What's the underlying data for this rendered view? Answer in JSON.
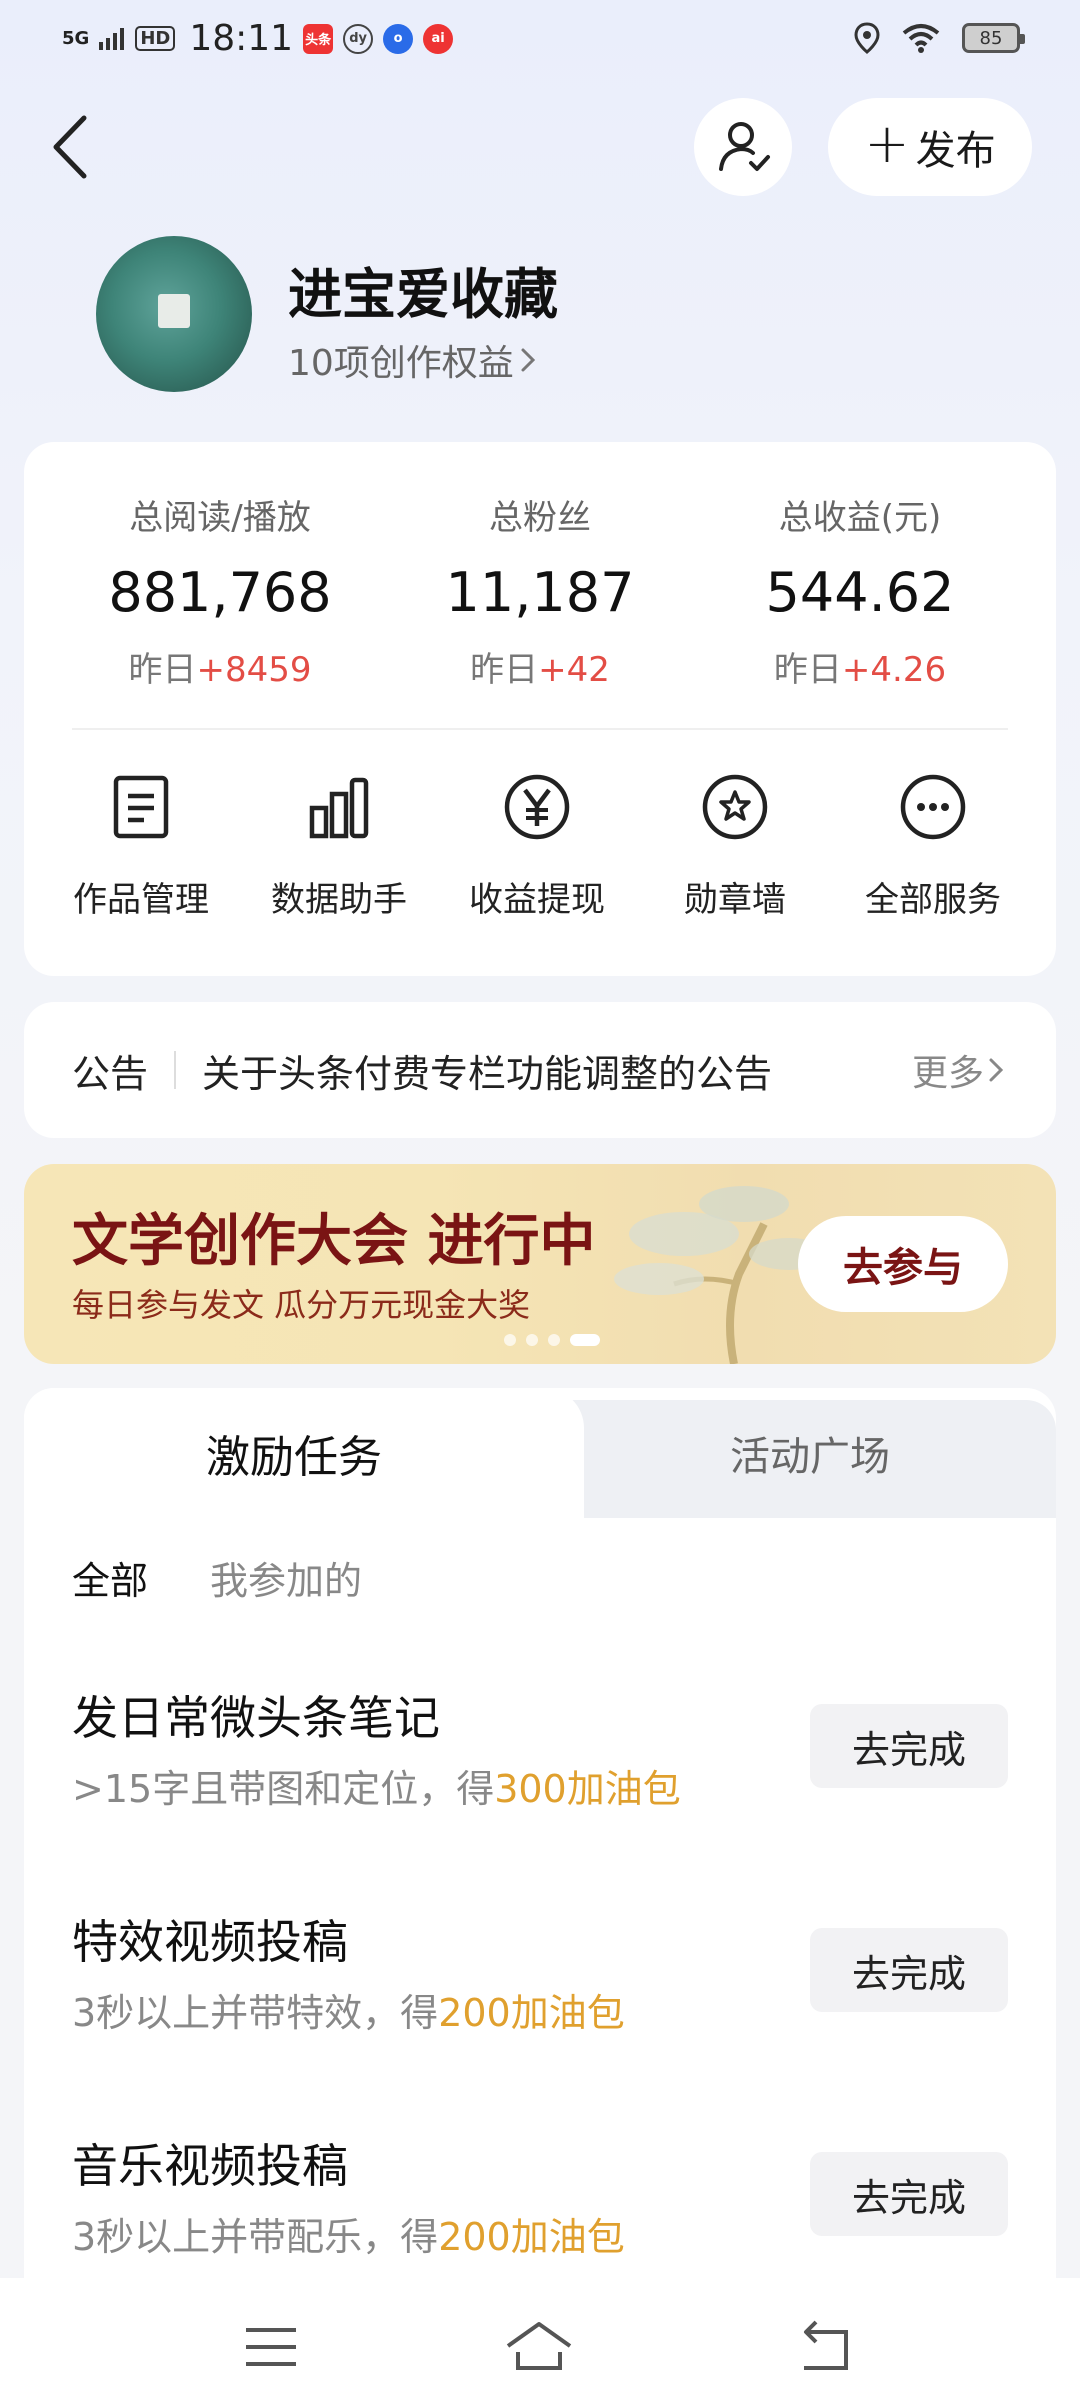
{
  "status_bar": {
    "network": "5G",
    "hd": "HD",
    "time": "18:11",
    "apps": [
      "头条",
      "dy",
      "o",
      "ai"
    ],
    "battery": "85"
  },
  "header": {
    "publish_label": "发布"
  },
  "profile": {
    "name": "进宝爱收藏",
    "subtitle": "10项创作权益"
  },
  "stats": [
    {
      "label": "总阅读/播放",
      "value": "881,768",
      "delta_prefix": "昨日",
      "delta": "+8459"
    },
    {
      "label": "总粉丝",
      "value": "11,187",
      "delta_prefix": "昨日",
      "delta": "+42"
    },
    {
      "label": "总收益(元)",
      "value": "544.62",
      "delta_prefix": "昨日",
      "delta": "+4.26"
    }
  ],
  "services": [
    {
      "label": "作品管理",
      "icon": "document-icon"
    },
    {
      "label": "数据助手",
      "icon": "bar-chart-icon"
    },
    {
      "label": "收益提现",
      "icon": "yuan-icon"
    },
    {
      "label": "勋章墙",
      "icon": "medal-icon"
    },
    {
      "label": "全部服务",
      "icon": "more-icon"
    }
  ],
  "notice": {
    "tag": "公告",
    "text": "关于头条付费专栏功能调整的公告",
    "more": "更多"
  },
  "banner": {
    "title": "文学创作大会 进行中",
    "subtitle": "每日参与发文 瓜分万元现金大奖",
    "button": "去参与",
    "dots": 4,
    "active_dot": 4
  },
  "tasks": {
    "tabs": [
      "激励任务",
      "活动广场"
    ],
    "filters": [
      "全部",
      "我参加的"
    ],
    "items": [
      {
        "title": "发日常微头条笔记",
        "desc": ">15字且带图和定位，得",
        "reward": "300加油包",
        "button": "去完成"
      },
      {
        "title": "特效视频投稿",
        "desc": "3秒以上并带特效，得",
        "reward": "200加油包",
        "button": "去完成"
      },
      {
        "title": "音乐视频投稿",
        "desc": "3秒以上并带配乐，得",
        "reward": "200加油包",
        "button": "去完成"
      }
    ]
  },
  "colors": {
    "accent_red": "#e34d45",
    "reward_orange": "#e0a02e",
    "banner_title": "#7a1414"
  }
}
